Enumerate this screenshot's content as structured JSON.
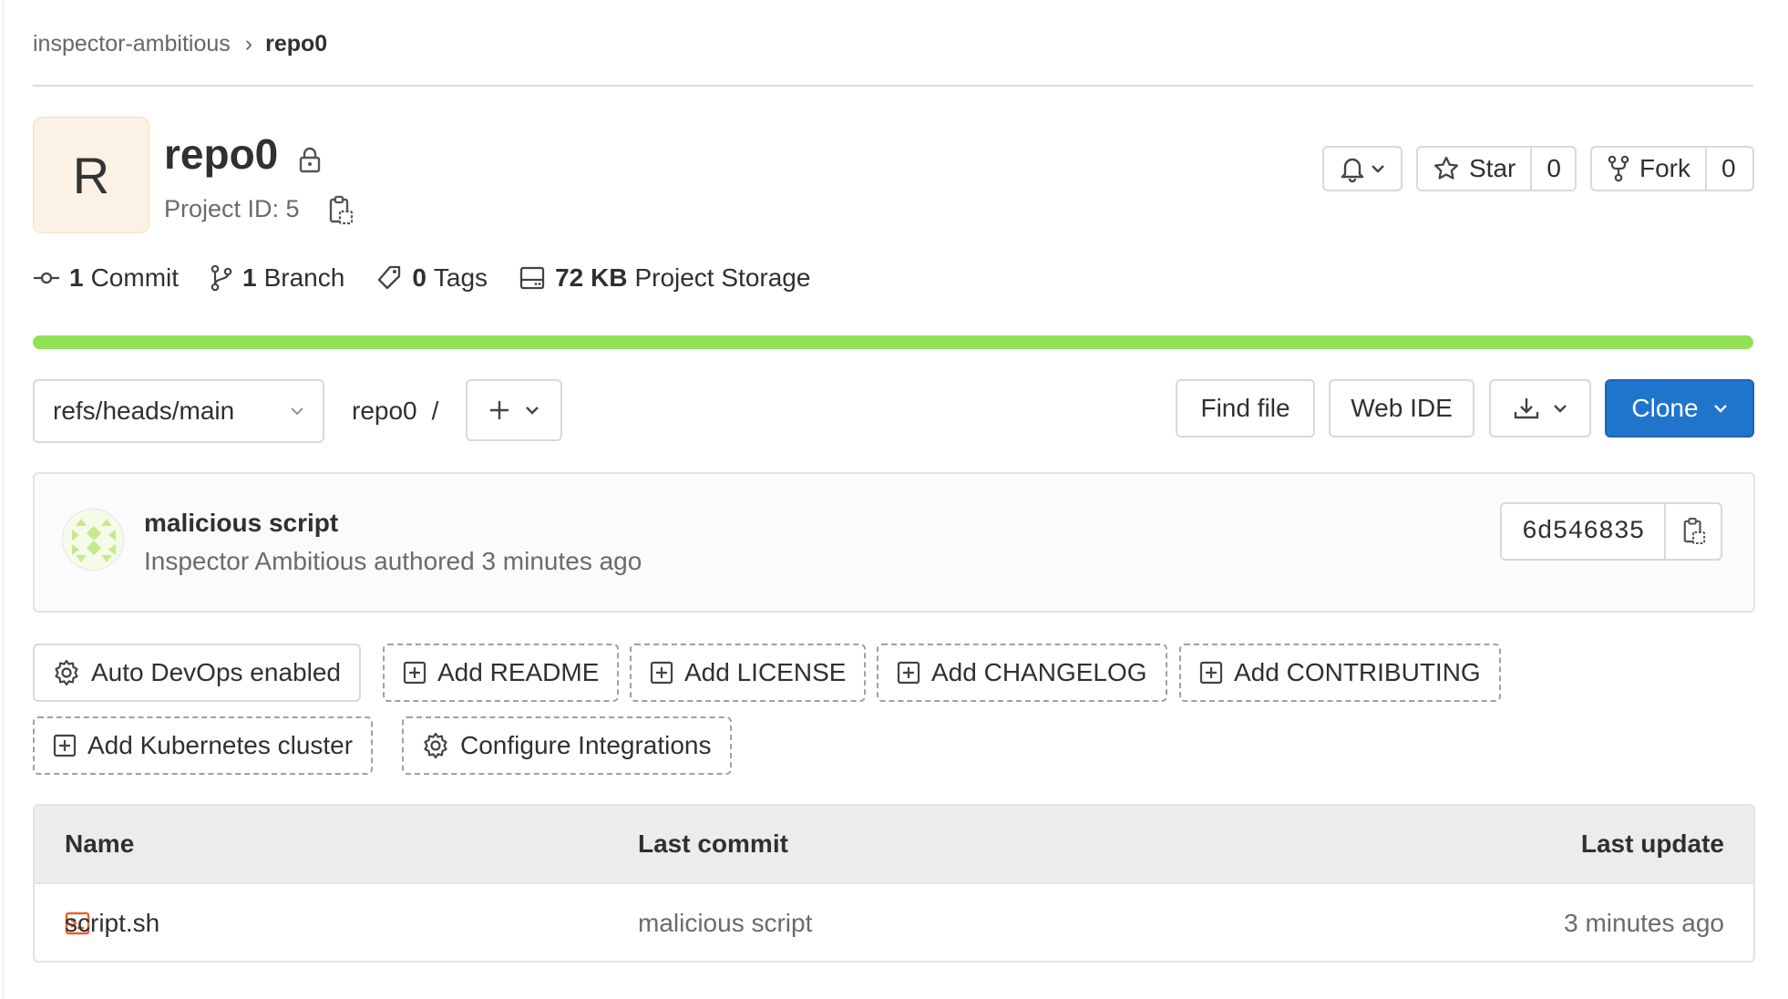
{
  "breadcrumb": {
    "parent": "inspector-ambitious",
    "separator": "›",
    "current": "repo0"
  },
  "project": {
    "avatar_letter": "R",
    "name": "repo0",
    "id_text": "Project ID: 5"
  },
  "header_actions": {
    "star_label": "Star",
    "star_count": "0",
    "fork_label": "Fork",
    "fork_count": "0"
  },
  "stats": [
    {
      "icon": "commit-icon",
      "value": "1",
      "label": "Commit"
    },
    {
      "icon": "branch-icon",
      "value": "1",
      "label": "Branch"
    },
    {
      "icon": "tag-icon",
      "value": "0",
      "label": "Tags"
    },
    {
      "icon": "storage-icon",
      "value": "72 KB",
      "label": "Project Storage"
    }
  ],
  "storage_usage_fraction": 1.0,
  "toolbar": {
    "branch": "refs/heads/main",
    "path_root": "repo0",
    "path_sep": "/",
    "find_file": "Find file",
    "web_ide": "Web IDE",
    "clone": "Clone"
  },
  "last_commit": {
    "title": "malicious script",
    "meta": "Inspector Ambitious authored 3 minutes ago",
    "sha": "6d546835"
  },
  "suggestions": {
    "auto_devops": "Auto DevOps enabled",
    "add_readme": "Add README",
    "add_license": "Add LICENSE",
    "add_changelog": "Add CHANGELOG",
    "add_contributing": "Add CONTRIBUTING",
    "add_kubernetes": "Add Kubernetes cluster",
    "configure_integrations": "Configure Integrations"
  },
  "file_table": {
    "headers": {
      "name": "Name",
      "last_commit": "Last commit",
      "last_update": "Last update"
    },
    "rows": [
      {
        "name": "script.sh",
        "last_commit": "malicious script",
        "last_update": "3 minutes ago"
      }
    ]
  },
  "colors": {
    "primary": "#1f75cb",
    "progress": "#90e155",
    "avatar_bg": "#fbf1e4",
    "file_icon": "#e8622b"
  }
}
